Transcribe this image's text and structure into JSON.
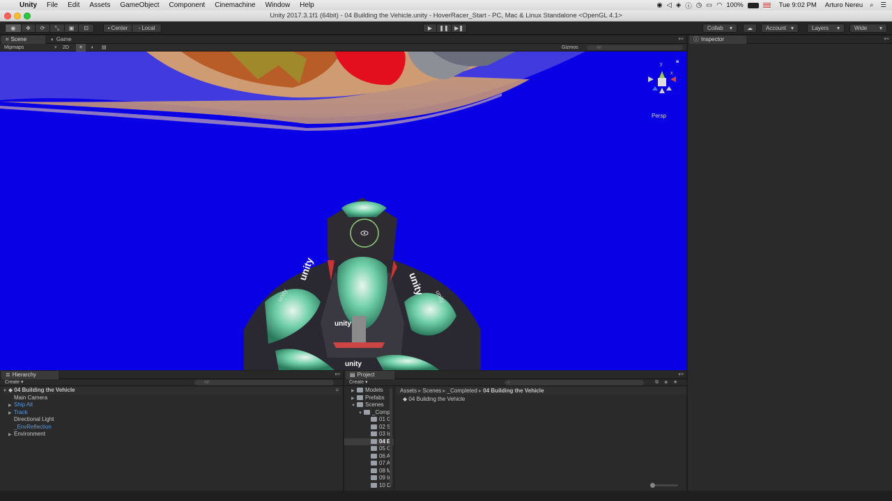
{
  "menubar": {
    "apple": "",
    "app_name": "Unity",
    "items": [
      "File",
      "Edit",
      "Assets",
      "GameObject",
      "Component",
      "Cinemachine",
      "Window",
      "Help"
    ],
    "battery": "100%",
    "clock": "Tue 9:02 PM",
    "user": "Arturo Nereu"
  },
  "window": {
    "title": "Unity 2017.3.1f1 (64bit) - 04 Building the Vehicle.unity - HoverRacer_Start - PC, Mac & Linux Standalone <OpenGL 4.1>"
  },
  "toolbar": {
    "pivot": "Center",
    "space": "Local",
    "collab": "Collab",
    "account": "Account",
    "layers": "Layers",
    "layout": "Wide"
  },
  "scene": {
    "tabs": [
      "Scene",
      "Game"
    ],
    "shading": "Mipmaps",
    "mode_2d": "2D",
    "gizmos": "Gizmos",
    "search_placeholder": "All",
    "persp": "Persp",
    "axis_y": "y",
    "axis_x": "x",
    "logo_text": "unity"
  },
  "inspector": {
    "tab": "Inspector"
  },
  "hierarchy": {
    "tab": "Hierarchy",
    "create": "Create",
    "search_placeholder": "All",
    "scene_name": "04 Building the Vehicle",
    "items": [
      "Main Camera",
      "Ship Alt",
      "Track",
      "Directional Light",
      "_EnvReflection",
      "Environment"
    ]
  },
  "project": {
    "tab": "Project",
    "create": "Create",
    "tree": [
      "Models",
      "Prefabs",
      "Scenes",
      "_Comp",
      "01 G",
      "02 S",
      "03 Ir",
      "04 B",
      "05 C",
      "06 A",
      "07 A",
      "08 M",
      "09 Ir",
      "10 D"
    ],
    "breadcrumb": [
      "Assets",
      "Scenes",
      "_Completed",
      "04 Building the Vehicle"
    ],
    "file": "04 Building the Vehicle"
  },
  "colors": {
    "viewport_bg": "#0a00e6",
    "link_blue": "#5c9be0"
  }
}
